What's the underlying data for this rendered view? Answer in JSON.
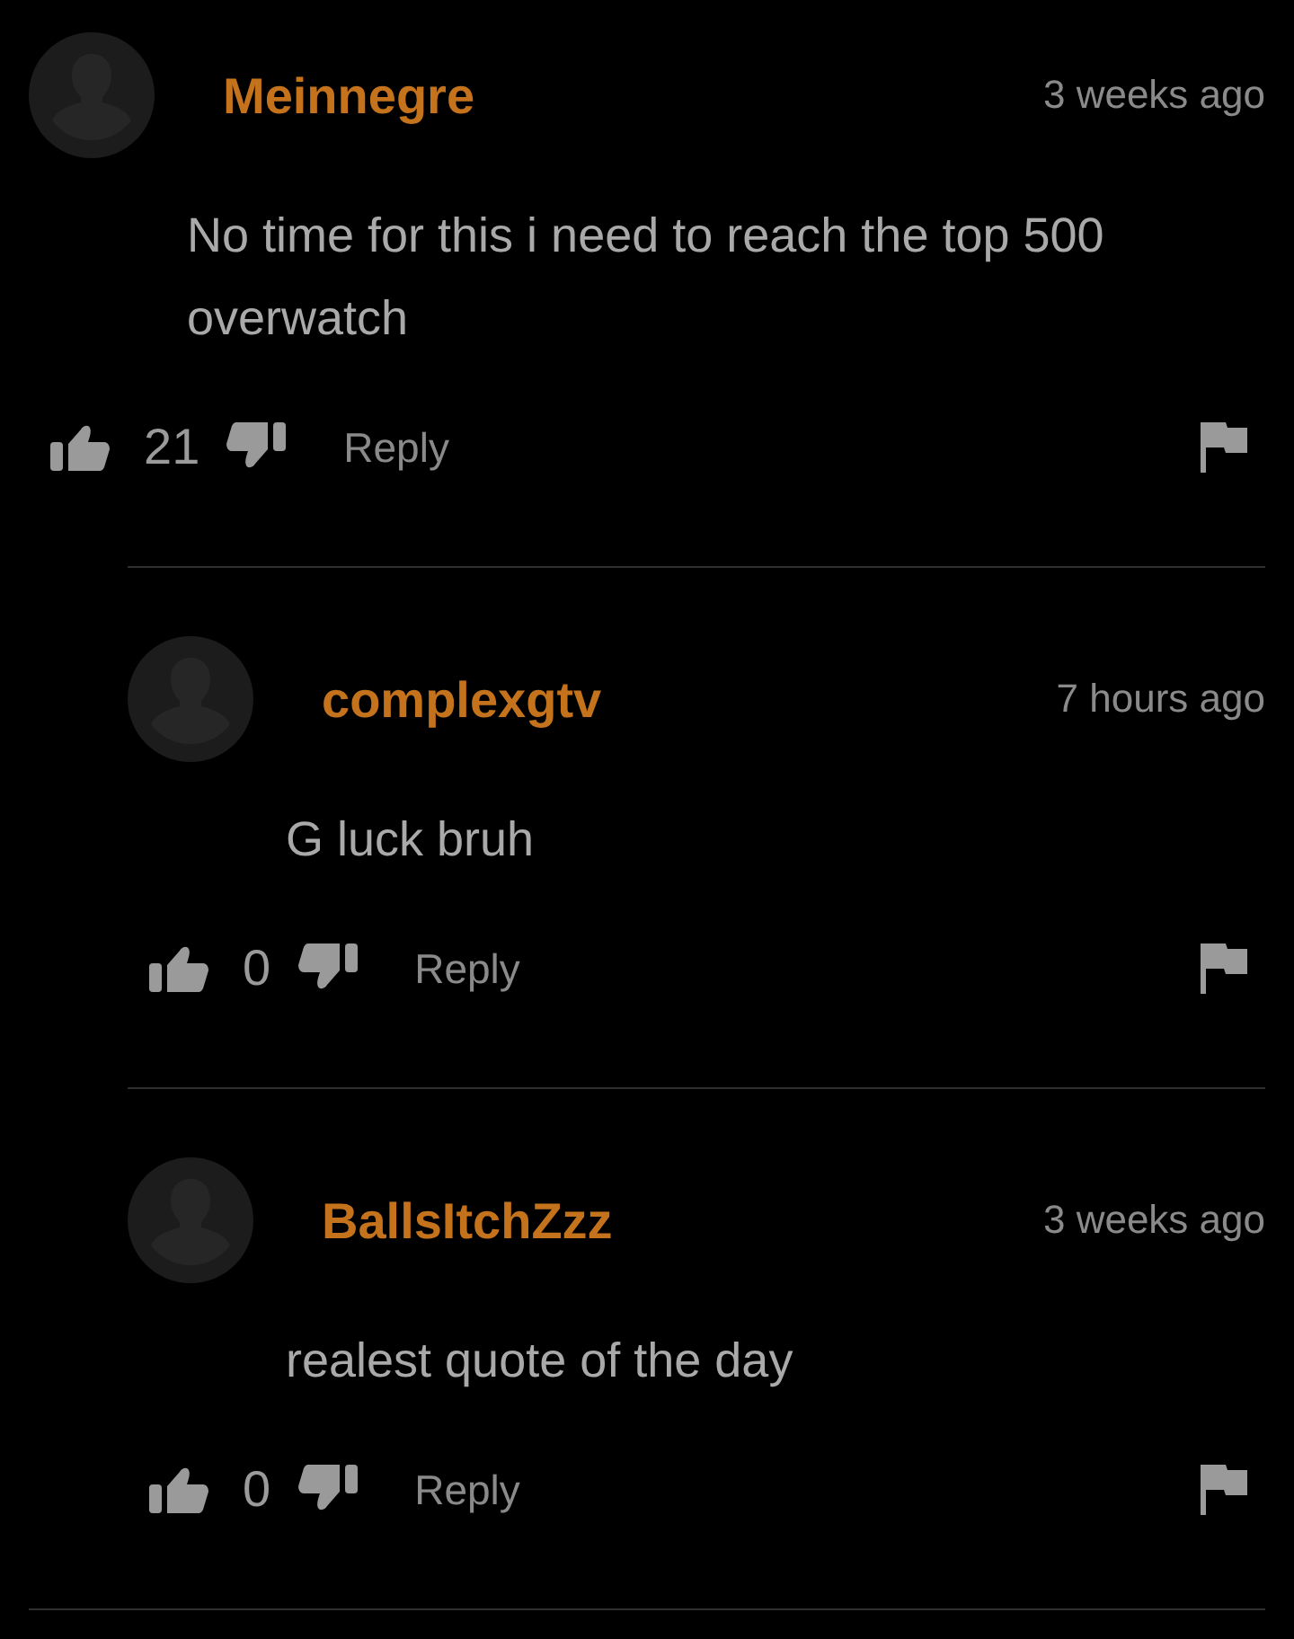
{
  "comments": [
    {
      "author": "Meinnegre",
      "time": "3 weeks ago",
      "text": "No time for this i need to reach the top 500 overwatch",
      "likes": "21",
      "reply_label": "Reply",
      "children": [
        {
          "author": "complexgtv",
          "time": "7 hours ago",
          "text": "G luck bruh",
          "likes": "0",
          "reply_label": "Reply"
        },
        {
          "author": "BallsItchZzz",
          "time": "3 weeks ago",
          "text": "realest quote of the day",
          "likes": "0",
          "reply_label": "Reply"
        }
      ]
    }
  ]
}
